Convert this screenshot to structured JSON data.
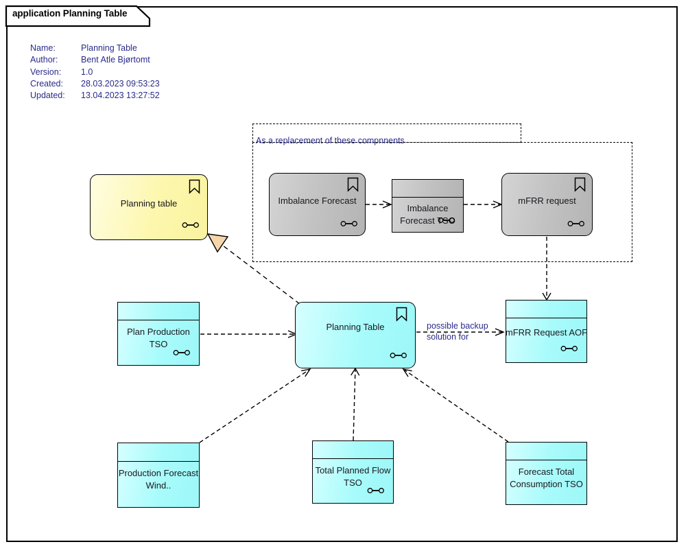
{
  "window": {
    "tab_label": "application Planning Table"
  },
  "metadata": {
    "rows": [
      {
        "key": "Name:",
        "value": "Planning Table"
      },
      {
        "key": "Author:",
        "value": "Bent Atle Bjørtomt"
      },
      {
        "key": "Version:",
        "value": "1.0"
      },
      {
        "key": "Created:",
        "value": "28.03.2023 09:53:23"
      },
      {
        "key": "Updated:",
        "value": "13.04.2023 13:27:52"
      }
    ]
  },
  "group": {
    "label": "As a replacement of these compnnents"
  },
  "nodes": {
    "planning_table_yellow": {
      "label": "Planning table"
    },
    "imbalance_forecast": {
      "label": "Imbalance Forecast"
    },
    "imbalance_forecast_tso": {
      "label_line1": "Imbalance",
      "label_line2": "Forecast TSO"
    },
    "mfrr_request": {
      "label": "mFRR request"
    },
    "planning_table_main": {
      "label": "Planning Table"
    },
    "mfrr_request_aof": {
      "label": "mFRR Request AOF"
    },
    "plan_production_tso": {
      "label_line1": "Plan Production",
      "label_line2": "TSO"
    },
    "production_forecast_wind": {
      "label_line1": "Production Forecast",
      "label_line2": "Wind.."
    },
    "total_planned_flow_tso": {
      "label_line1": "Total Planned Flow",
      "label_line2": "TSO"
    },
    "forecast_total_consumption_tso": {
      "label_line1": "Forecast Total",
      "label_line2": "Consumption TSO"
    }
  },
  "edges": {
    "backup_solution": {
      "label_line1": "possible backup",
      "label_line2": "solution for"
    }
  },
  "colors": {
    "cyan": "#a8fbfb",
    "yellow": "#fdf7ae",
    "gray": "#c2c2c2",
    "text_blue": "#2a2a8c",
    "line": "#000000",
    "generalization_fill": "#f5d6ab"
  }
}
